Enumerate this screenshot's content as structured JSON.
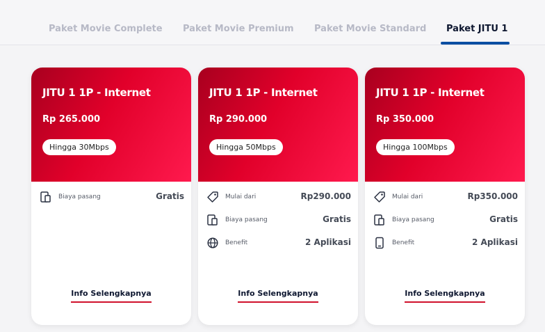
{
  "tabs": [
    {
      "label": "Paket Movie Complete"
    },
    {
      "label": "Paket Movie Premium"
    },
    {
      "label": "Paket Movie Standard"
    },
    {
      "label": "Paket JITU 1"
    }
  ],
  "cards": [
    {
      "title": "JITU 1 1P - Internet",
      "price": "Rp 265.000",
      "speed": "Hingga 30Mbps",
      "rows": [
        {
          "icon": "devices-icon",
          "label": "Biaya pasang",
          "value": "Gratis"
        }
      ],
      "link": "Info Selengkapnya"
    },
    {
      "title": "JITU 1 1P - Internet",
      "price": "Rp 290.000",
      "speed": "Hingga 50Mbps",
      "rows": [
        {
          "icon": "price-tag-icon",
          "label": "Mulai dari",
          "value": "Rp290.000"
        },
        {
          "icon": "devices-icon",
          "label": "Biaya pasang",
          "value": "Gratis"
        },
        {
          "icon": "globe-icon",
          "label": "Benefit",
          "value": "2 Aplikasi"
        }
      ],
      "link": "Info Selengkapnya"
    },
    {
      "title": "JITU 1 1P - Internet",
      "price": "Rp 350.000",
      "speed": "Hingga 100Mbps",
      "rows": [
        {
          "icon": "price-tag-icon",
          "label": "Mulai dari",
          "value": "Rp350.000"
        },
        {
          "icon": "devices-icon",
          "label": "Biaya pasang",
          "value": "Gratis"
        },
        {
          "icon": "smartphone-icon",
          "label": "Benefit",
          "value": "2 Aplikasi"
        }
      ],
      "link": "Info Selengkapnya"
    }
  ],
  "colors": {
    "accent": "#e1002a",
    "active_tab_underline": "#0b4ea2",
    "link_underline": "#d0112b"
  }
}
